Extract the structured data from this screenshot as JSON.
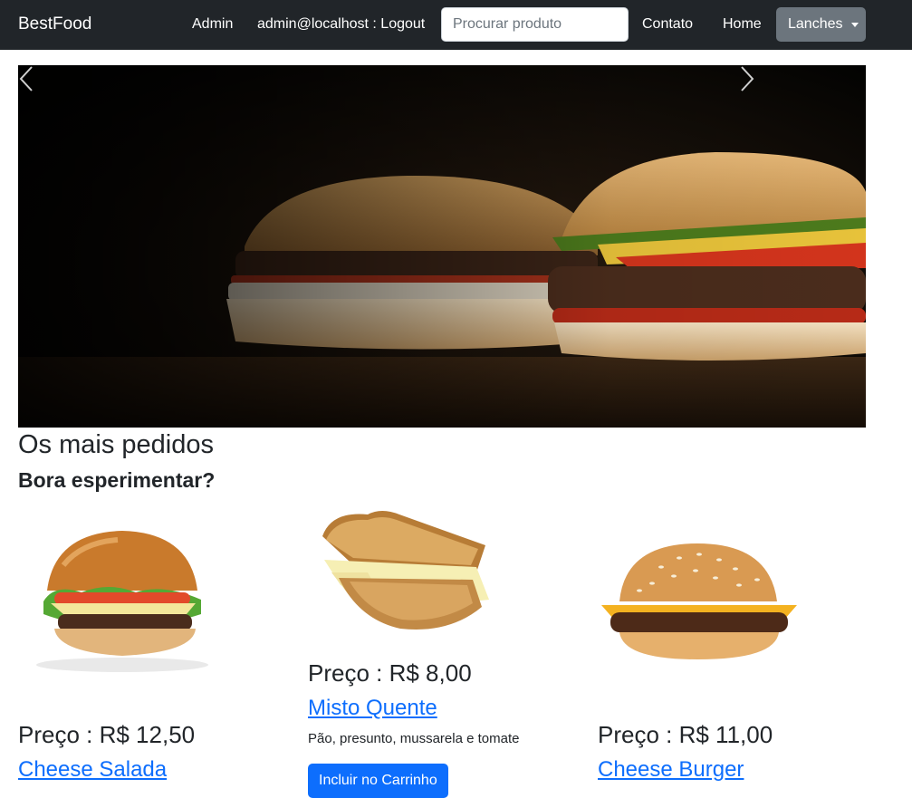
{
  "navbar": {
    "brand": "BestFood",
    "admin_link": "Admin",
    "logout_link": "admin@localhost : Logout",
    "search_placeholder": "Procurar produto",
    "contato_link": "Contato",
    "home_link": "Home",
    "dropdown_label": "Lanches"
  },
  "carousel": {
    "image": "burger-hero-photo",
    "prev_icon": "chevron-left-icon",
    "next_icon": "chevron-right-icon"
  },
  "section": {
    "title": "Os mais pedidos",
    "subtitle": "Bora esperimentar?"
  },
  "products": [
    {
      "image": "cheese-salada-photo",
      "price": "Preço : R$ 12,50",
      "name": "Cheese Salada"
    },
    {
      "image": "misto-quente-photo",
      "price": "Preço : R$ 8,00",
      "name": "Misto Quente",
      "description": "Pão, presunto, mussarela e tomate",
      "button": "Incluir no Carrinho"
    },
    {
      "image": "cheese-burger-photo",
      "price": "Preço : R$ 11,00",
      "name": "Cheese Burger"
    }
  ],
  "colors": {
    "navbar_bg": "#212529",
    "link_blue": "#0d6efd",
    "dropdown_bg": "#6c757d"
  }
}
